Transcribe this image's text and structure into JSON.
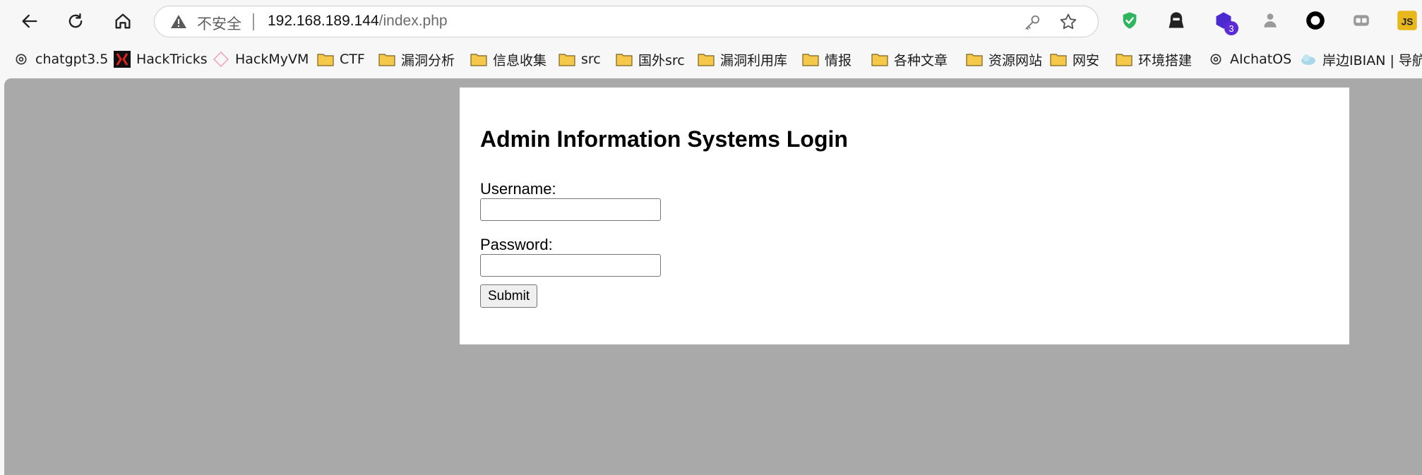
{
  "toolbar": {
    "back_icon": "back-arrow-icon",
    "refresh_icon": "refresh-icon",
    "home_icon": "home-icon"
  },
  "address_bar": {
    "security_label": "不安全",
    "host": "192.168.189.144",
    "path": "/index.php"
  },
  "extensions": [
    {
      "name": "shield-check-icon",
      "color": "#2fb55d"
    },
    {
      "name": "hacker-icon",
      "color": "#222222"
    },
    {
      "name": "purple-cube-icon",
      "color": "#4b2bd0",
      "badge": "3"
    },
    {
      "name": "puzzle-gray-icon",
      "color": "#9a9a9a"
    },
    {
      "name": "ring-icon",
      "color": "#000000"
    },
    {
      "name": "tab-icon",
      "color": "#9a9a9a"
    },
    {
      "name": "js-icon",
      "color": "#e8b71b"
    }
  ],
  "bookmarks": [
    {
      "label": "chatgpt3.5",
      "icon": "openai-icon"
    },
    {
      "label": "HackTricks",
      "icon": "hacktricks-icon"
    },
    {
      "label": "HackMyVM",
      "icon": "diamond-icon"
    },
    {
      "label": "CTF",
      "icon": "folder-icon"
    },
    {
      "label": "漏洞分析",
      "icon": "folder-icon"
    },
    {
      "label": "信息收集",
      "icon": "folder-icon"
    },
    {
      "label": "src",
      "icon": "folder-icon"
    },
    {
      "label": "国外src",
      "icon": "folder-icon"
    },
    {
      "label": "漏洞利用库",
      "icon": "folder-icon"
    },
    {
      "label": "情报",
      "icon": "folder-icon"
    },
    {
      "label": "各种文章",
      "icon": "folder-icon"
    },
    {
      "label": "资源网站",
      "icon": "folder-icon"
    },
    {
      "label": "网安",
      "icon": "folder-icon"
    },
    {
      "label": "环境搭建",
      "icon": "folder-icon"
    },
    {
      "label": "AIchatOS",
      "icon": "openai-icon"
    },
    {
      "label": "岸边IBIAN | 导航E",
      "icon": "cloud-icon"
    }
  ],
  "page": {
    "title": "Admin Information Systems Login",
    "username_label": "Username:",
    "username_value": "",
    "password_label": "Password:",
    "password_value": "",
    "submit_label": "Submit"
  },
  "colors": {
    "page_background": "#a9a9a9",
    "card_background": "#ffffff",
    "chrome_background": "#f7f7f7",
    "folder_fill": "#f5c84a"
  }
}
